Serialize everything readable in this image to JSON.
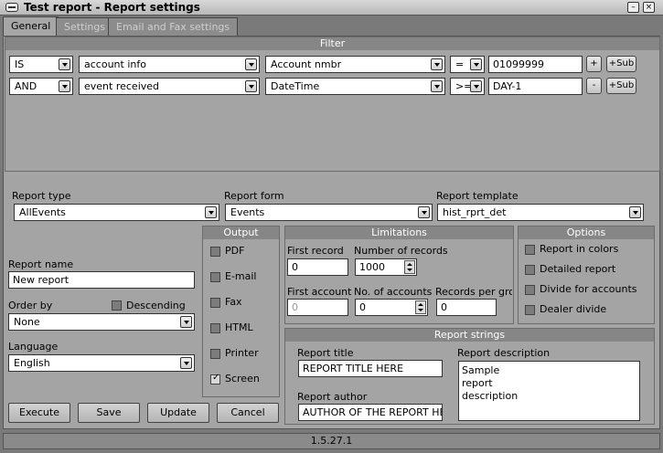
{
  "window": {
    "title": "Test report - Report settings"
  },
  "tabs": [
    {
      "label": "General",
      "active": true
    },
    {
      "label": "Settings",
      "active": false
    },
    {
      "label": "Email and Fax settings",
      "active": false
    }
  ],
  "filter": {
    "title": "Filter",
    "rows": [
      {
        "op": "IS",
        "table": "account info",
        "field": "Account nmbr",
        "cmp": "=",
        "value": "01099999",
        "pm": "+",
        "sub": "+Sub"
      },
      {
        "op": "AND",
        "table": "event received",
        "field": "DateTime",
        "cmp": ">=",
        "value": "DAY-1",
        "pm": "-",
        "sub": "+Sub"
      }
    ]
  },
  "report_type": {
    "label": "Report type",
    "value": "AllEvents"
  },
  "report_form": {
    "label": "Report form",
    "value": "Events"
  },
  "report_template": {
    "label": "Report template",
    "value": "hist_rprt_det"
  },
  "report_name": {
    "label": "Report name",
    "value": "New report"
  },
  "order_by": {
    "label": "Order by",
    "value": "None",
    "descending_label": "Descending",
    "descending": false
  },
  "language": {
    "label": "Language",
    "value": "English"
  },
  "output": {
    "title": "Output",
    "items": [
      {
        "label": "PDF",
        "checked": false
      },
      {
        "label": "E-mail",
        "checked": false
      },
      {
        "label": "Fax",
        "checked": false
      },
      {
        "label": "HTML",
        "checked": false
      },
      {
        "label": "Printer",
        "checked": false
      },
      {
        "label": "Screen",
        "checked": true
      }
    ]
  },
  "limitations": {
    "title": "Limitations",
    "first_record": {
      "label": "First record",
      "value": "0"
    },
    "num_records": {
      "label": "Number of records",
      "value": "1000"
    },
    "first_account": {
      "label": "First account",
      "value": "0"
    },
    "num_accounts": {
      "label": "No. of accounts",
      "value": "0"
    },
    "records_per_group": {
      "label": "Records per grou",
      "value": "0"
    }
  },
  "options": {
    "title": "Options",
    "items": [
      {
        "label": "Report in colors",
        "checked": false
      },
      {
        "label": "Detailed report",
        "checked": false
      },
      {
        "label": "Divide for accounts",
        "checked": false
      },
      {
        "label": "Dealer divide",
        "checked": false
      }
    ]
  },
  "report_strings": {
    "title": "Report strings",
    "title_label": "Report title",
    "title_value": "REPORT TITLE HERE",
    "author_label": "Report author",
    "author_value": "AUTHOR OF THE REPORT HERE",
    "description_label": "Report description",
    "description_lines": [
      "Sample",
      "report",
      "description"
    ]
  },
  "buttons": {
    "execute": "Execute",
    "save": "Save",
    "update": "Update",
    "cancel": "Cancel"
  },
  "status": {
    "version": "1.5.27.1"
  }
}
